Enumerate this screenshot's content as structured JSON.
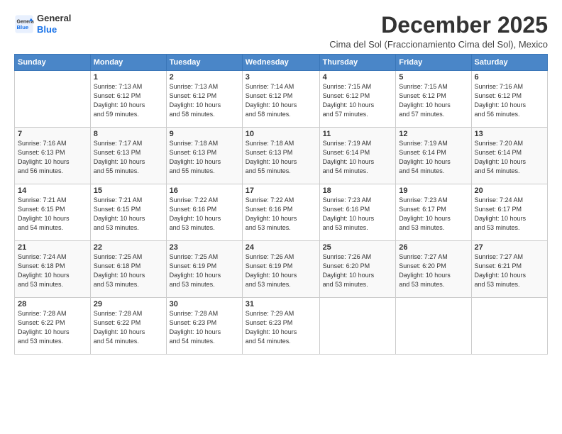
{
  "logo": {
    "line1": "General",
    "line2": "Blue"
  },
  "title": "December 2025",
  "subtitle": "Cima del Sol (Fraccionamiento Cima del Sol), Mexico",
  "days_header": [
    "Sunday",
    "Monday",
    "Tuesday",
    "Wednesday",
    "Thursday",
    "Friday",
    "Saturday"
  ],
  "weeks": [
    [
      {
        "day": "",
        "info": ""
      },
      {
        "day": "1",
        "info": "Sunrise: 7:13 AM\nSunset: 6:12 PM\nDaylight: 10 hours\nand 59 minutes."
      },
      {
        "day": "2",
        "info": "Sunrise: 7:13 AM\nSunset: 6:12 PM\nDaylight: 10 hours\nand 58 minutes."
      },
      {
        "day": "3",
        "info": "Sunrise: 7:14 AM\nSunset: 6:12 PM\nDaylight: 10 hours\nand 58 minutes."
      },
      {
        "day": "4",
        "info": "Sunrise: 7:15 AM\nSunset: 6:12 PM\nDaylight: 10 hours\nand 57 minutes."
      },
      {
        "day": "5",
        "info": "Sunrise: 7:15 AM\nSunset: 6:12 PM\nDaylight: 10 hours\nand 57 minutes."
      },
      {
        "day": "6",
        "info": "Sunrise: 7:16 AM\nSunset: 6:12 PM\nDaylight: 10 hours\nand 56 minutes."
      }
    ],
    [
      {
        "day": "7",
        "info": "Sunrise: 7:16 AM\nSunset: 6:13 PM\nDaylight: 10 hours\nand 56 minutes."
      },
      {
        "day": "8",
        "info": "Sunrise: 7:17 AM\nSunset: 6:13 PM\nDaylight: 10 hours\nand 55 minutes."
      },
      {
        "day": "9",
        "info": "Sunrise: 7:18 AM\nSunset: 6:13 PM\nDaylight: 10 hours\nand 55 minutes."
      },
      {
        "day": "10",
        "info": "Sunrise: 7:18 AM\nSunset: 6:13 PM\nDaylight: 10 hours\nand 55 minutes."
      },
      {
        "day": "11",
        "info": "Sunrise: 7:19 AM\nSunset: 6:14 PM\nDaylight: 10 hours\nand 54 minutes."
      },
      {
        "day": "12",
        "info": "Sunrise: 7:19 AM\nSunset: 6:14 PM\nDaylight: 10 hours\nand 54 minutes."
      },
      {
        "day": "13",
        "info": "Sunrise: 7:20 AM\nSunset: 6:14 PM\nDaylight: 10 hours\nand 54 minutes."
      }
    ],
    [
      {
        "day": "14",
        "info": "Sunrise: 7:21 AM\nSunset: 6:15 PM\nDaylight: 10 hours\nand 54 minutes."
      },
      {
        "day": "15",
        "info": "Sunrise: 7:21 AM\nSunset: 6:15 PM\nDaylight: 10 hours\nand 53 minutes."
      },
      {
        "day": "16",
        "info": "Sunrise: 7:22 AM\nSunset: 6:16 PM\nDaylight: 10 hours\nand 53 minutes."
      },
      {
        "day": "17",
        "info": "Sunrise: 7:22 AM\nSunset: 6:16 PM\nDaylight: 10 hours\nand 53 minutes."
      },
      {
        "day": "18",
        "info": "Sunrise: 7:23 AM\nSunset: 6:16 PM\nDaylight: 10 hours\nand 53 minutes."
      },
      {
        "day": "19",
        "info": "Sunrise: 7:23 AM\nSunset: 6:17 PM\nDaylight: 10 hours\nand 53 minutes."
      },
      {
        "day": "20",
        "info": "Sunrise: 7:24 AM\nSunset: 6:17 PM\nDaylight: 10 hours\nand 53 minutes."
      }
    ],
    [
      {
        "day": "21",
        "info": "Sunrise: 7:24 AM\nSunset: 6:18 PM\nDaylight: 10 hours\nand 53 minutes."
      },
      {
        "day": "22",
        "info": "Sunrise: 7:25 AM\nSunset: 6:18 PM\nDaylight: 10 hours\nand 53 minutes."
      },
      {
        "day": "23",
        "info": "Sunrise: 7:25 AM\nSunset: 6:19 PM\nDaylight: 10 hours\nand 53 minutes."
      },
      {
        "day": "24",
        "info": "Sunrise: 7:26 AM\nSunset: 6:19 PM\nDaylight: 10 hours\nand 53 minutes."
      },
      {
        "day": "25",
        "info": "Sunrise: 7:26 AM\nSunset: 6:20 PM\nDaylight: 10 hours\nand 53 minutes."
      },
      {
        "day": "26",
        "info": "Sunrise: 7:27 AM\nSunset: 6:20 PM\nDaylight: 10 hours\nand 53 minutes."
      },
      {
        "day": "27",
        "info": "Sunrise: 7:27 AM\nSunset: 6:21 PM\nDaylight: 10 hours\nand 53 minutes."
      }
    ],
    [
      {
        "day": "28",
        "info": "Sunrise: 7:28 AM\nSunset: 6:22 PM\nDaylight: 10 hours\nand 53 minutes."
      },
      {
        "day": "29",
        "info": "Sunrise: 7:28 AM\nSunset: 6:22 PM\nDaylight: 10 hours\nand 54 minutes."
      },
      {
        "day": "30",
        "info": "Sunrise: 7:28 AM\nSunset: 6:23 PM\nDaylight: 10 hours\nand 54 minutes."
      },
      {
        "day": "31",
        "info": "Sunrise: 7:29 AM\nSunset: 6:23 PM\nDaylight: 10 hours\nand 54 minutes."
      },
      {
        "day": "",
        "info": ""
      },
      {
        "day": "",
        "info": ""
      },
      {
        "day": "",
        "info": ""
      }
    ]
  ]
}
